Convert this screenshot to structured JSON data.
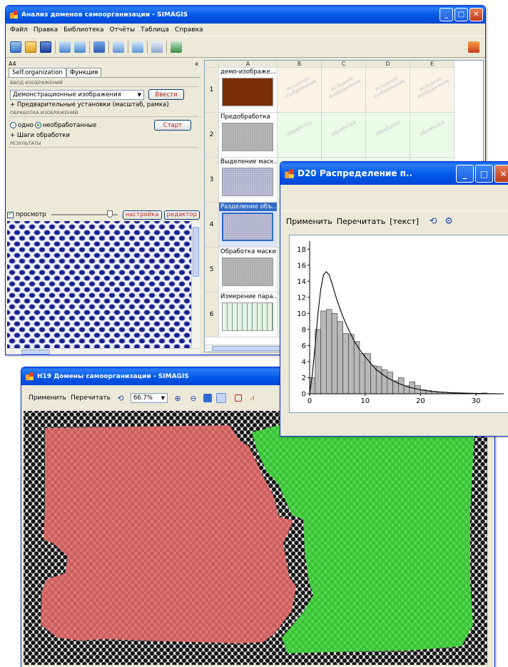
{
  "main_window": {
    "title": "Анализ доменов самоорганизации - SIMAGIS",
    "menu": [
      "Файл",
      "Правка",
      "Библиотека",
      "Отчёты",
      "Таблица",
      "Справка"
    ],
    "cell_ref": "A4",
    "close_pane": "x",
    "tabs": [
      "Self.organization",
      "Функция"
    ],
    "sections": {
      "input": "ВВОД ИЗОБРАЖЕНИЙ",
      "processing": "ОБРАБОТКА ИЗОБРАЖЕНИЙ",
      "results": "РЕЗУЛЬТАТЫ"
    },
    "source_select": "Демонстрационные изображения",
    "enter_button": "Ввести",
    "presets": "+ Предварительные установки (масштаб, рамка)",
    "radio_one": "одно",
    "radio_unprocessed": "необработанные",
    "start_button": "Старт",
    "steps": "+ Шаги обработки",
    "preview_label": "просмотр",
    "settings_button": "настройка",
    "editor_button": "редактор",
    "columns": [
      "A",
      "B",
      "C",
      "D",
      "E"
    ],
    "rows": [
      {
        "num": "1",
        "title": "демо-изображе...",
        "thumb": "brown"
      },
      {
        "num": "2",
        "title": "Предобработка",
        "thumb": "noise"
      },
      {
        "num": "3",
        "title": "Выделение маск...",
        "thumb": "noise-blue"
      },
      {
        "num": "4",
        "title": "Разделение объ...",
        "thumb": "noise-blue"
      },
      {
        "num": "5",
        "title": "Обработка маски",
        "thumb": "noise"
      },
      {
        "num": "6",
        "title": "Измерение пара...",
        "thumb": "chart"
      }
    ],
    "watermark_row1": "исходное изображение",
    "watermark_row2": "обработка"
  },
  "histogram_window": {
    "title": "D20 Распределение п..",
    "toolbar": [
      "Применить",
      "Перечитать",
      "[текст]"
    ]
  },
  "domains_window": {
    "title": "H19 Домены самоорганизации - SIMAGIS",
    "apply": "Применить",
    "reread": "Перечитать",
    "zoom": "66.7%"
  },
  "colors": {
    "xp_blue": "#0058e8",
    "red_domain": "#e26a6a",
    "green_domain": "#42d93f",
    "bar_fill": "#b8b8b8"
  },
  "chart_data": {
    "type": "bar",
    "xlim": [
      0,
      35
    ],
    "ylim": [
      0,
      19
    ],
    "x_ticks": [
      0,
      10,
      20,
      30
    ],
    "y_ticks": [
      0,
      2,
      4,
      6,
      8,
      10,
      12,
      14,
      16,
      18
    ],
    "bin_width": 1,
    "bin_start": 0,
    "values": [
      2,
      8,
      10.3,
      10.5,
      10,
      9,
      7.5,
      7.4,
      6.5,
      5,
      5,
      3.5,
      3.4,
      3,
      2.7,
      1.6,
      2,
      1,
      1.5,
      1,
      0.5,
      0.4,
      0.3,
      0.2,
      0.2,
      0.1,
      0.1,
      0,
      0,
      0,
      0,
      0.1,
      0,
      0,
      0
    ],
    "curve": {
      "x": [
        0,
        0.5,
        1,
        1.5,
        2,
        2.5,
        3,
        3.5,
        4,
        5,
        6,
        7,
        8,
        9,
        10,
        12,
        14,
        16,
        18,
        20,
        22,
        25,
        28,
        32,
        35
      ],
      "y": [
        0,
        2.5,
        6,
        10,
        13,
        14.8,
        15.2,
        14.8,
        13.8,
        11.5,
        9.6,
        8,
        6.6,
        5.5,
        4.6,
        3,
        2,
        1.3,
        0.8,
        0.5,
        0.3,
        0.15,
        0.08,
        0.02,
        0
      ]
    },
    "grid": false,
    "legend": "none"
  }
}
